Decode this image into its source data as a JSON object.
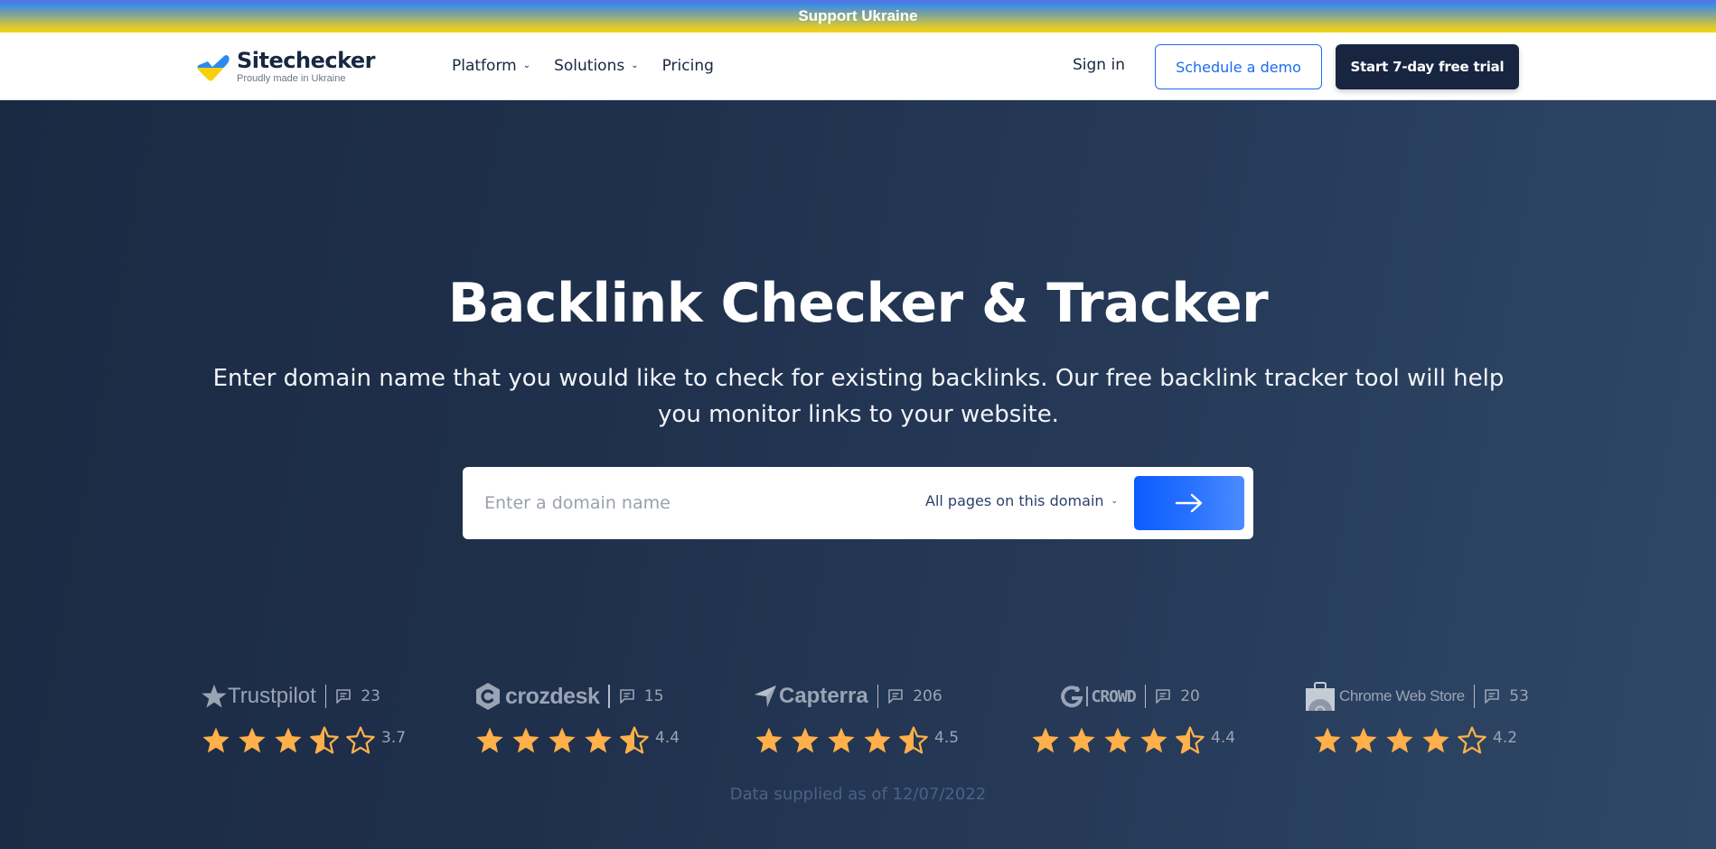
{
  "banner": {
    "text": "Support Ukraine"
  },
  "header": {
    "logo_name": "Sitechecker",
    "logo_tagline": "Proudly made in Ukraine",
    "nav": [
      {
        "label": "Platform",
        "has_dropdown": true
      },
      {
        "label": "Solutions",
        "has_dropdown": true
      },
      {
        "label": "Pricing",
        "has_dropdown": false
      }
    ],
    "sign_in": "Sign in",
    "schedule_demo": "Schedule a demo",
    "start_trial": "Start 7-day free trial"
  },
  "hero": {
    "title": "Backlink Checker & Tracker",
    "subtitle": "Enter domain name that you would like to check for existing backlinks. Our free backlink tracker tool will help you monitor links to your website.",
    "search": {
      "value": "",
      "placeholder": "Enter a domain name",
      "scope_selected": "All pages on this domain",
      "submit_icon": "arrow-right-icon"
    }
  },
  "ratings": [
    {
      "brand": "Trustpilot",
      "icon": "trustpilot-star-icon",
      "reviews": "23",
      "score": "3.7",
      "rating_value": 3.7
    },
    {
      "brand": "crozdesk",
      "icon": "crozdesk-logo-icon",
      "reviews": "15",
      "score": "4.4",
      "rating_value": 4.4
    },
    {
      "brand": "Capterra",
      "icon": "capterra-logo-icon",
      "reviews": "206",
      "score": "4.5",
      "rating_value": 4.5
    },
    {
      "brand": "CROWD",
      "icon": "g2-logo-icon",
      "reviews": "20",
      "score": "4.4",
      "rating_value": 4.4
    },
    {
      "brand": "Chrome Web Store",
      "icon": "chrome-web-store-icon",
      "reviews": "53",
      "score": "4.2",
      "rating_value": 4.2
    }
  ],
  "data_note": "Data supplied as of 12/07/2022",
  "colors": {
    "brand_dark": "#172540",
    "accent_blue": "#1d6cf0",
    "star_fill": "#ffb04a",
    "muted_text": "#9aa4b4"
  }
}
